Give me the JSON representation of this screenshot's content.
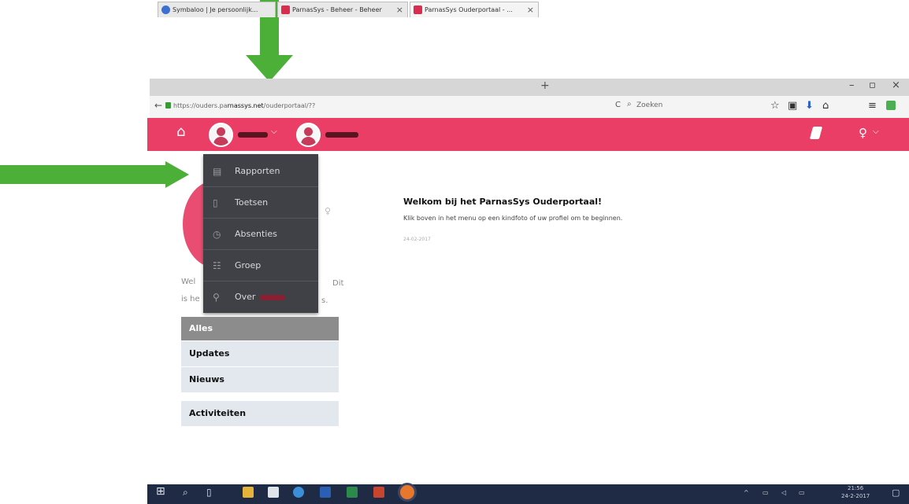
{
  "browser": {
    "tabs": [
      {
        "label": "Symbaloo | Je persoonlijk..."
      },
      {
        "label": "ParnasSys - Beheer - Beheer"
      },
      {
        "label": "ParnasSys Ouderportaal - ..."
      }
    ],
    "tab_close": "×",
    "new_tab": "+",
    "minimize": "–",
    "maximize": "▫",
    "close": "×",
    "url_prefix": "https://ouders.pa",
    "url_domain": "rnassys.net",
    "url_suffix": "/ouderportaal/??",
    "search_placeholder": "Zoeken",
    "reload_glyph": "C"
  },
  "navbar": {
    "home_glyph": "⌂",
    "dropdown_caret": "⌵",
    "user_glyph": "♀",
    "user_caret": "⌵",
    "colors": {
      "brand": "#eb3e66"
    }
  },
  "dropdown": {
    "items": [
      {
        "label": "Rapporten",
        "icon": "▤"
      },
      {
        "label": "Toetsen",
        "icon": "▯"
      },
      {
        "label": "Absenties",
        "icon": "◷"
      },
      {
        "label": "Groep",
        "icon": "☷"
      },
      {
        "label": "Over",
        "icon": "⚲"
      }
    ]
  },
  "main": {
    "welcome_title": "Welkom bij het ParnasSys Ouderportaal!",
    "welcome_text": "Klik boven in het menu op een kindfoto of uw profiel om te beginnen.",
    "welcome_date": "24-02-2017",
    "partial_left_1": "Wel",
    "partial_left_2": "is he",
    "partial_right_1": "Dit",
    "partial_right_2": "s."
  },
  "filter_menu": {
    "items": [
      {
        "label": "Alles"
      },
      {
        "label": "Updates"
      },
      {
        "label": "Nieuws"
      },
      {
        "label": "Activiteiten"
      }
    ]
  },
  "taskbar": {
    "time": "21:56",
    "date": "24-2-2017"
  }
}
